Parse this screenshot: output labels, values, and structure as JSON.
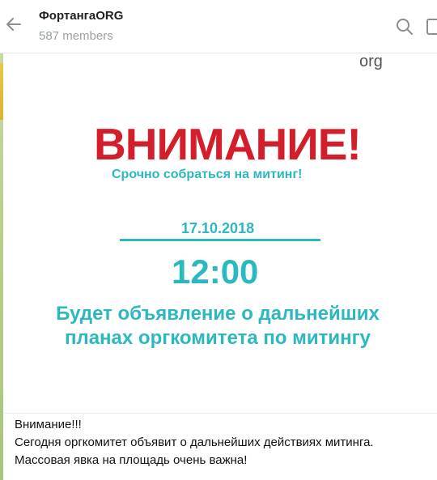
{
  "header": {
    "title": "ФортангаORG",
    "members": "587 members",
    "back_icon": "arrow-left-icon",
    "search_icon": "search-icon",
    "side_icon": "sidebar-icon"
  },
  "message": {
    "image": {
      "org": "org",
      "headline": "ВНИМАНИЕ!",
      "subheadline": "Срочно собраться на митинг!",
      "date": "17.10.2018",
      "time": "12:00",
      "announcement": "Будет объявление о дальнейших планах оргкомитета по митингу"
    },
    "text_lines": [
      "Внимание!!!",
      "Сегодня оргкомитет объявит о дальнейших действиях митинга.",
      "Массовая явка на площадь очень важна!"
    ]
  },
  "colors": {
    "accent_red": "#d21f2b",
    "accent_teal": "#2bb8bf"
  }
}
